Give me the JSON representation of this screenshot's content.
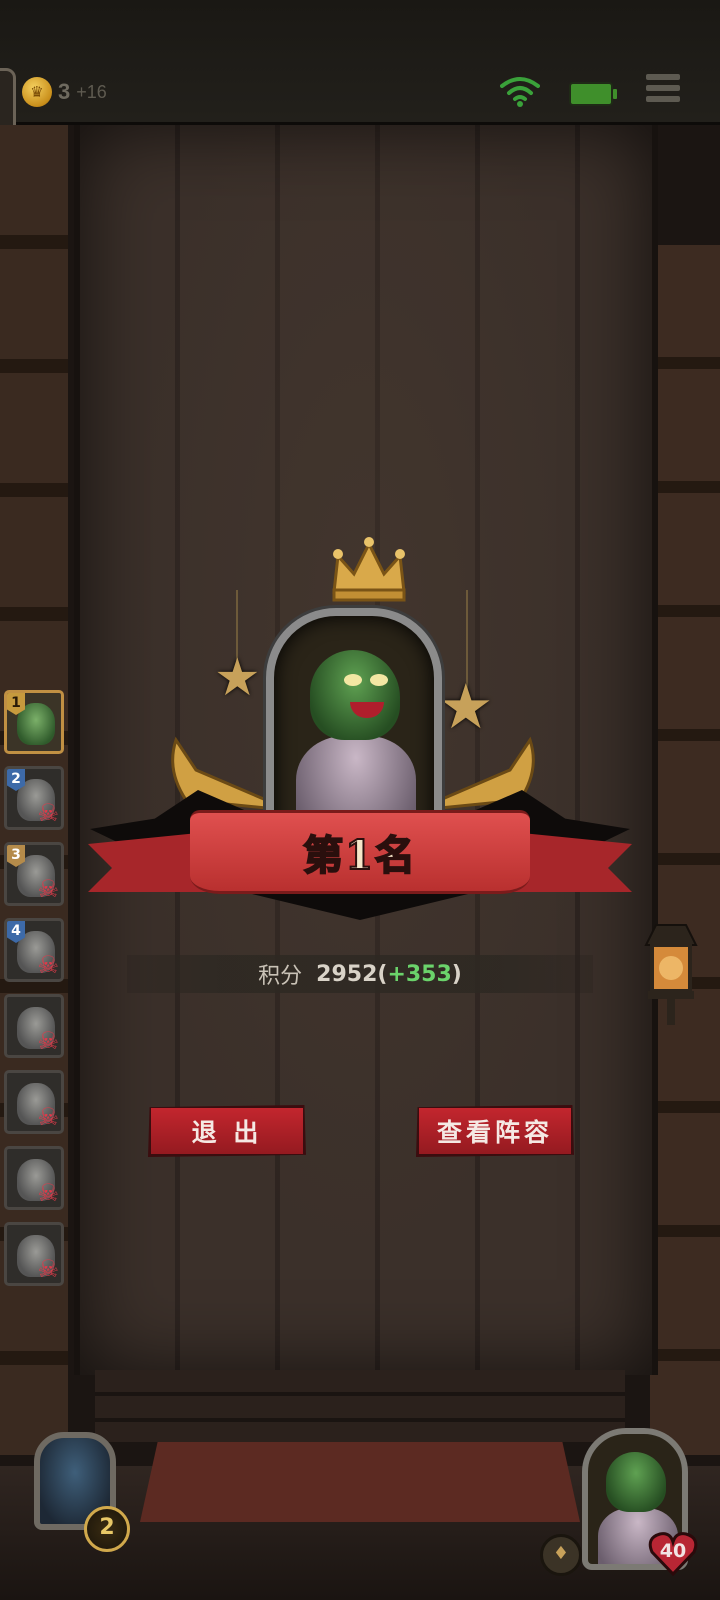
{
  "topbar": {
    "gold_icon": "crown-coin-icon",
    "gold": "3",
    "gold_income": "+16",
    "wifi_icon": "wifi-icon",
    "battery_icon": "battery-icon",
    "menu_icon": "menu-icon",
    "colors": {
      "wifi": "#3aa13a",
      "battery": "#3f8f2b"
    }
  },
  "players": [
    {
      "rank": "1",
      "eliminated": false
    },
    {
      "rank": "2",
      "eliminated": true
    },
    {
      "rank": "3",
      "eliminated": true
    },
    {
      "rank": "4",
      "eliminated": true
    },
    {
      "rank": "",
      "eliminated": true
    },
    {
      "rank": "",
      "eliminated": true
    },
    {
      "rank": "",
      "eliminated": true
    },
    {
      "rank": "",
      "eliminated": true
    }
  ],
  "result": {
    "rank_text": "第1名",
    "score_label": "积分",
    "score_value": "2952",
    "score_open": "(",
    "score_delta": "+353",
    "score_close": ")"
  },
  "buttons": {
    "exit": "退 出",
    "view_lineup": "查看阵容"
  },
  "hud": {
    "hero_level": "2",
    "health": "40",
    "bell_icon": "bell-icon"
  },
  "colors": {
    "accent_red": "#c3262e",
    "ribbon_red": "#d8413f",
    "gold": "#d1a94c",
    "delta_green": "#6bd36b",
    "skull_red": "#e03a4a"
  }
}
